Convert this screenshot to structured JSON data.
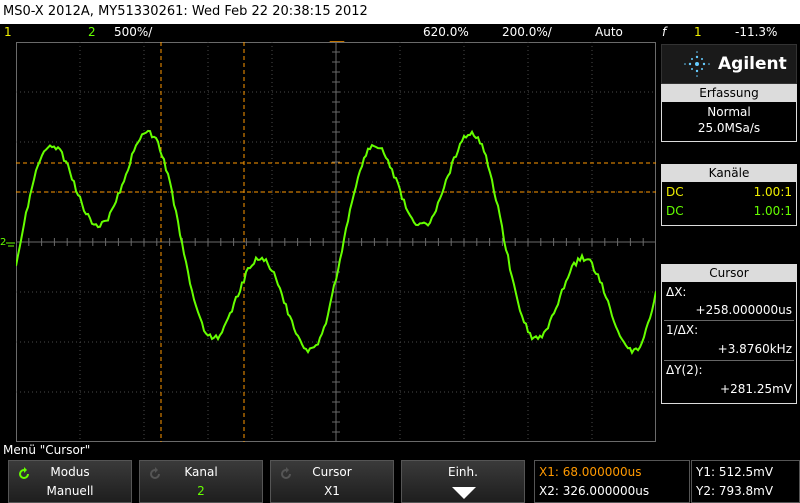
{
  "title": "MS0-X 2012A, MY51330261: Wed Feb 22 20:38:15 2012",
  "statusbar": {
    "ch1_num": "1",
    "ch2_num": "2",
    "ch2_scale": "500%/",
    "time_delay": "620.0%",
    "time_scale": "200.0%/",
    "trigger_mode": "Auto",
    "trigger_icon": "f",
    "trigger_src": "1",
    "trigger_level": "-11.3%"
  },
  "panel": {
    "brand": "Agilent",
    "acq_head": "Erfassung",
    "acq_mode": "Normal",
    "acq_rate": "25.0MSa/s",
    "ch_head": "Kanäle",
    "ch1_coupling": "DC",
    "ch1_probe": "1.00:1",
    "ch2_coupling": "DC",
    "ch2_probe": "1.00:1",
    "cursor_head": "Cursor",
    "dx_label": "ΔX:",
    "dx_value": "+258.000000us",
    "inv_dx_label": "1/ΔX:",
    "inv_dx_value": "+3.8760kHz",
    "dy_label": "ΔY(2):",
    "dy_value": "+281.25mV"
  },
  "menu": {
    "title": "Menü \"Cursor\"",
    "softkeys": [
      {
        "line1": "Modus",
        "line2": "Manuell"
      },
      {
        "line1": "Kanal",
        "line2": "2"
      },
      {
        "line1": "Cursor",
        "line2": "X1"
      },
      {
        "line1": "Einh.",
        "line2": ""
      }
    ],
    "x1": "X1: 68.000000us",
    "x2": "X2: 326.000000us",
    "y1": "Y1: 512.5mV",
    "y2": "Y2: 793.8mV"
  },
  "colors": {
    "ch1": "#f0f000",
    "ch2": "#66ff00",
    "cursor": "#ff9900",
    "grid": "#4a4a4a"
  }
}
